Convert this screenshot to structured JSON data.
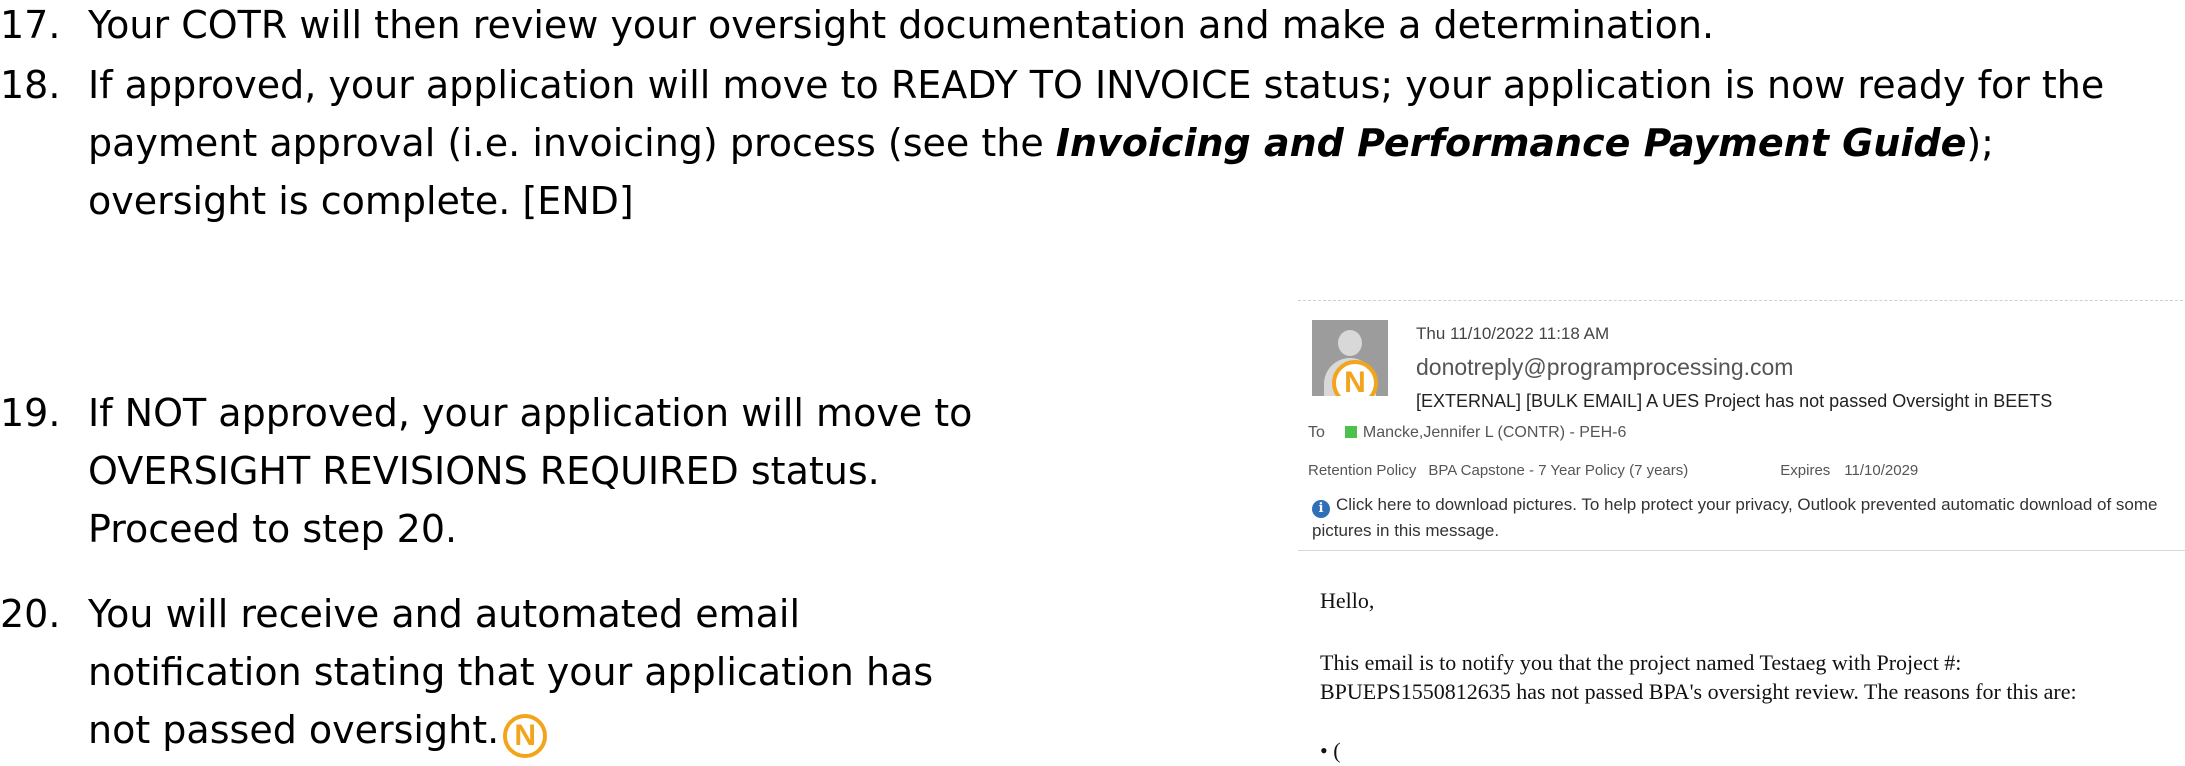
{
  "steps": [
    {
      "num": "17.",
      "text": "Your COTR will then review your oversight documentation and make a determination."
    },
    {
      "num": "18.",
      "text_before": "If approved, your application will move to READY TO INVOICE status; your application is now ready for the payment approval (i.e. invoicing) process (see the ",
      "emphasis": "Invoicing and Performance Payment Guide",
      "text_after": "); oversight is complete. [END]"
    },
    {
      "num": "19.",
      "text": "If NOT approved, your application will move to OVERSIGHT REVISIONS REQUIRED status. Proceed to step 20."
    },
    {
      "num": "20.",
      "text": "You will receive and automated email notification stating that your application has not passed oversight."
    }
  ],
  "badge_letter": "N",
  "email": {
    "date": "Thu 11/10/2022 11:18 AM",
    "from": "donotreply@programprocessing.com",
    "subject": "[EXTERNAL] [BULK EMAIL] A UES Project has not passed Oversight in BEETS",
    "to_label": "To",
    "to": "Mancke,Jennifer L (CONTR) - PEH-6",
    "retention_label": "Retention Policy",
    "retention_value": "BPA Capstone - 7 Year Policy (7 years)",
    "expires_label": "Expires",
    "expires_value": "11/10/2029",
    "info_text": "Click here to download pictures. To help protect your privacy, Outlook prevented automatic download of some pictures in this message.",
    "greeting": "Hello,",
    "body_line1": "This email is to notify you that the project named Testaeg with Project #:",
    "body_line2": "BPUEPS1550812635 has not passed BPA's oversight review. The reasons for this are:",
    "bullet": "• ("
  }
}
